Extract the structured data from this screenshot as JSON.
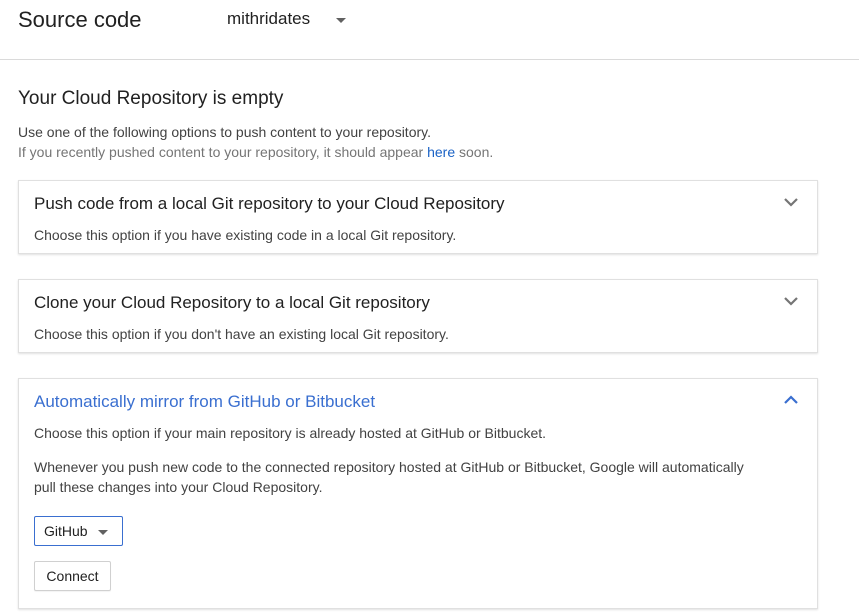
{
  "header": {
    "title": "Source code",
    "repo_name": "mithridates"
  },
  "empty_state": {
    "heading": "Your Cloud Repository is empty",
    "intro": "Use one of the following options to push content to your repository.",
    "hint_prefix": "If you recently pushed content to your repository, it should appear ",
    "hint_link": "here",
    "hint_suffix": " soon."
  },
  "options": [
    {
      "title": "Push code from a local Git repository to your Cloud Repository",
      "description": "Choose this option if you have existing code in a local Git repository.",
      "expanded": false
    },
    {
      "title": "Clone your Cloud Repository to a local Git repository",
      "description": "Choose this option if you don't have an existing local Git repository.",
      "expanded": false
    },
    {
      "title": "Automatically mirror from GitHub or Bitbucket",
      "description": "Choose this option if your main repository is already hosted at GitHub or Bitbucket.",
      "note": "Whenever you push new code to the connected repository hosted at GitHub or Bitbucket, Google will automatically pull these changes into your Cloud Repository.",
      "provider_selected": "GitHub",
      "connect_label": "Connect",
      "expanded": true
    }
  ],
  "colors": {
    "accent": "#3a6fd0",
    "link": "#1a62c5",
    "chevron": "#757575"
  },
  "icons": {
    "collapsed": "chevron-down-icon",
    "expanded": "chevron-up-icon",
    "dropdown": "caret-down-icon"
  }
}
